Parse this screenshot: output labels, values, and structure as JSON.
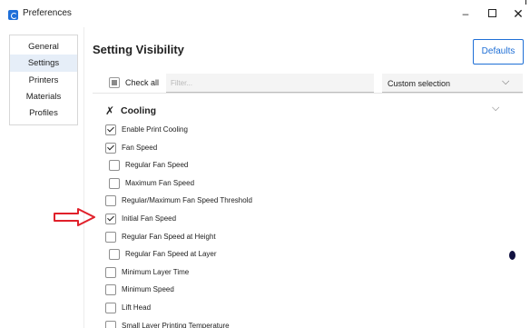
{
  "window": {
    "title": "Preferences",
    "minimize_glyph": "–",
    "close_glyph": "✕"
  },
  "nav": {
    "items": [
      {
        "label": "General"
      },
      {
        "label": "Settings"
      },
      {
        "label": "Printers"
      },
      {
        "label": "Materials"
      },
      {
        "label": "Profiles"
      }
    ],
    "selected": "Settings"
  },
  "main": {
    "heading": "Setting Visibility",
    "defaults_label": "Defaults",
    "check_all_label": "Check all",
    "filter_placeholder": "Filter...",
    "filter_value": "",
    "visibility_select": "Custom selection",
    "chevron_glyph": "⌵"
  },
  "category": {
    "icon": "fan-icon",
    "icon_glyph": "✗",
    "label": "Cooling"
  },
  "settings": [
    {
      "label": "Enable Print Cooling",
      "checked": true,
      "indent": 0
    },
    {
      "label": "Fan Speed",
      "checked": true,
      "indent": 0
    },
    {
      "label": "Regular Fan Speed",
      "checked": false,
      "indent": 1
    },
    {
      "label": "Maximum Fan Speed",
      "checked": false,
      "indent": 1
    },
    {
      "label": "Regular/Maximum Fan Speed Threshold",
      "checked": false,
      "indent": 0
    },
    {
      "label": "Initial Fan Speed",
      "checked": true,
      "indent": 0
    },
    {
      "label": "Regular Fan Speed at Height",
      "checked": false,
      "indent": 0
    },
    {
      "label": "Regular Fan Speed at Layer",
      "checked": false,
      "indent": 1
    },
    {
      "label": "Minimum Layer Time",
      "checked": false,
      "indent": 0
    },
    {
      "label": "Minimum Speed",
      "checked": false,
      "indent": 0
    },
    {
      "label": "Lift Head",
      "checked": false,
      "indent": 0
    },
    {
      "label": "Small Layer Printing Temperature",
      "checked": false,
      "indent": 0
    }
  ],
  "annotation": {
    "type": "arrow",
    "color": "#e0202a",
    "points_to": "Initial Fan Speed"
  }
}
